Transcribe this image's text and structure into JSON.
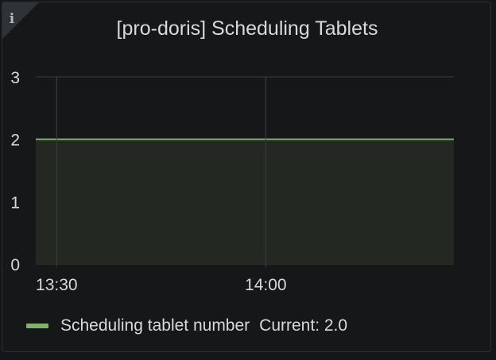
{
  "panel": {
    "title": "[pro-doris] Scheduling Tablets",
    "info_icon": "info-icon"
  },
  "colors": {
    "series": "#7eb26d",
    "fill": "#232822",
    "grid": "#3a3c40",
    "text": "#d8d9da"
  },
  "legend": {
    "series_name": "Scheduling tablet number",
    "current_text": "Current: 2.0"
  },
  "chart_data": {
    "type": "area",
    "title": "[pro-doris] Scheduling Tablets",
    "xlabel": "",
    "ylabel": "",
    "x_ticks": [
      "13:30",
      "14:00"
    ],
    "y_ticks": [
      0,
      1,
      2,
      3
    ],
    "ylim": [
      0,
      3
    ],
    "xlim": [
      "13:27",
      "14:27"
    ],
    "grid": true,
    "legend_position": "bottom-left",
    "series": [
      {
        "name": "Scheduling tablet number",
        "x": [
          "13:27",
          "14:27"
        ],
        "values": [
          2,
          2
        ],
        "current": 2.0
      }
    ]
  }
}
